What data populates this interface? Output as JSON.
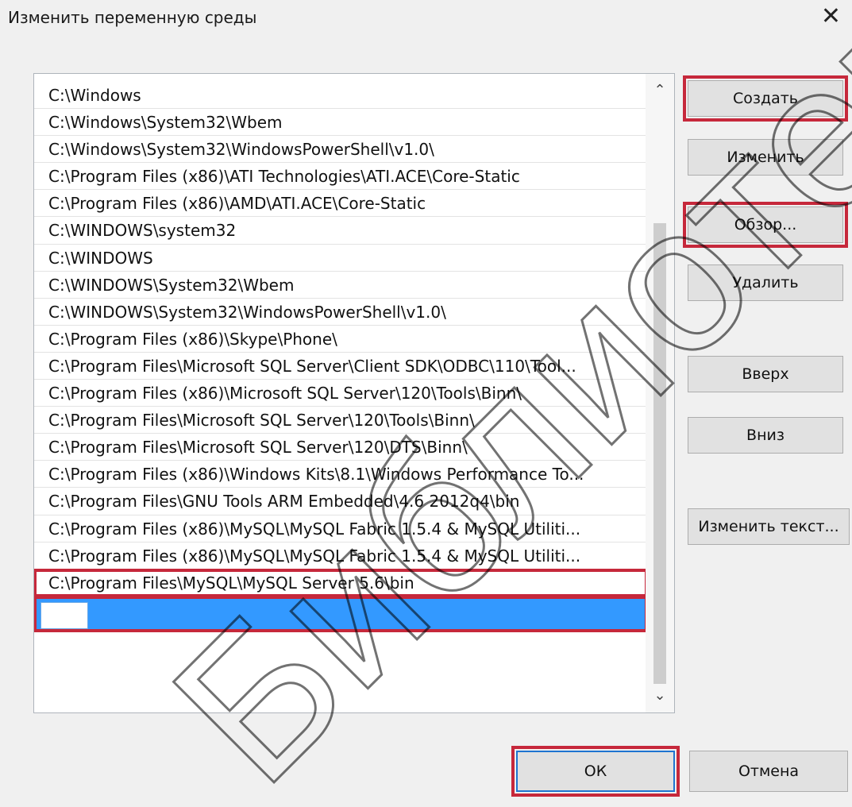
{
  "dialog": {
    "title": "Изменить переменную среды",
    "close_glyph": "✕"
  },
  "list": {
    "items": [
      "C:\\Windows",
      "C:\\Windows\\System32\\Wbem",
      "C:\\Windows\\System32\\WindowsPowerShell\\v1.0\\",
      "C:\\Program Files (x86)\\ATI Technologies\\ATI.ACE\\Core-Static",
      "C:\\Program Files (x86)\\AMD\\ATI.ACE\\Core-Static",
      "C:\\WINDOWS\\system32",
      "C:\\WINDOWS",
      "C:\\WINDOWS\\System32\\Wbem",
      "C:\\WINDOWS\\System32\\WindowsPowerShell\\v1.0\\",
      "C:\\Program Files (x86)\\Skype\\Phone\\",
      "C:\\Program Files\\Microsoft SQL Server\\Client SDK\\ODBC\\110\\Tool...",
      "C:\\Program Files (x86)\\Microsoft SQL Server\\120\\Tools\\Binn\\",
      "C:\\Program Files\\Microsoft SQL Server\\120\\Tools\\Binn\\",
      "C:\\Program Files\\Microsoft SQL Server\\120\\DTS\\Binn\\",
      "C:\\Program Files (x86)\\Windows Kits\\8.1\\Windows Performance To...",
      "C:\\Program Files\\GNU Tools ARM Embedded\\4.6 2012q4\\bin",
      "C:\\Program Files (x86)\\MySQL\\MySQL Fabric 1.5.4 & MySQL Utiliti...",
      "C:\\Program Files (x86)\\MySQL\\MySQL Fabric 1.5.4 & MySQL Utiliti...",
      "C:\\Program Files\\MySQL\\MySQL Server 5.6\\bin"
    ],
    "new_entry_value": ""
  },
  "scrollbar": {
    "up_glyph": "⌃",
    "down_glyph": "⌄"
  },
  "buttons": {
    "create": "Создать",
    "edit": "Изменить",
    "browse": "Обзор...",
    "delete": "Удалить",
    "up": "Вверх",
    "down": "Вниз",
    "edit_text": "Изменить текст...",
    "ok": "ОК",
    "cancel": "Отмена"
  },
  "watermark": {
    "text": "Библиотека БГУИР"
  },
  "colors": {
    "highlight": "#c6283b",
    "selection": "#3399ff"
  }
}
